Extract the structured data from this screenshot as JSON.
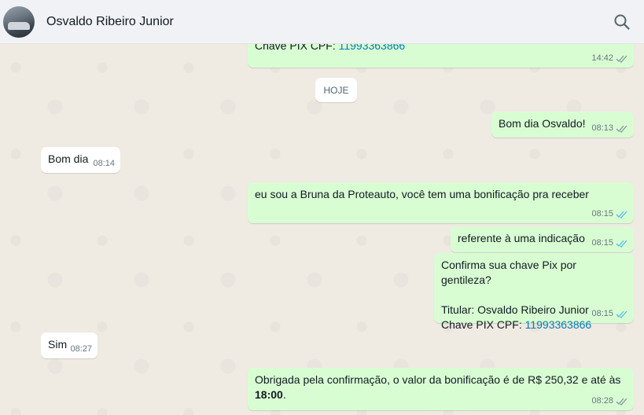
{
  "header": {
    "contact_name": "Osvaldo Ribeiro Junior",
    "search_icon": "search-icon",
    "avatar_icon": "profile-photo"
  },
  "chat": {
    "date_separator": "HOJE",
    "messages": [
      {
        "direction": "out",
        "text": "Chave PIX CPF: ",
        "link": "11993363866",
        "time": "14:42",
        "status": "delivered"
      },
      {
        "direction": "out",
        "text": "Bom dia Osvaldo!",
        "time": "08:13",
        "status": "delivered"
      },
      {
        "direction": "in",
        "text": "Bom dia",
        "time": "08:14"
      },
      {
        "direction": "out",
        "text": "eu sou a Bruna da Proteauto, você tem uma bonificação pra receber",
        "time": "08:15",
        "status": "read"
      },
      {
        "direction": "out",
        "text": "referente à uma indicação",
        "time": "08:15",
        "status": "read"
      },
      {
        "direction": "out",
        "line1": "Confirma sua chave Pix por gentileza?",
        "line2": "Titular: Osvaldo Ribeiro Junior",
        "line3": "Chave PIX CPF: ",
        "link": "11993363866",
        "time": "08:15",
        "status": "read"
      },
      {
        "direction": "in",
        "text": "Sim",
        "time": "08:27"
      },
      {
        "direction": "out",
        "text": "Obrigada pela confirmação, o valor da bonificação é de R$ 250,32 e até às",
        "bold": "18:00",
        "after": ".",
        "time": "08:28",
        "status": "delivered"
      }
    ]
  },
  "colors": {
    "outgoing_bubble": "#d9fdd3",
    "incoming_bubble": "#ffffff",
    "chat_background": "#efeae2",
    "header_background": "#f0f2f5",
    "link": "#027eb5",
    "read_ticks": "#53bdeb",
    "delivered_ticks": "#8696a0"
  }
}
